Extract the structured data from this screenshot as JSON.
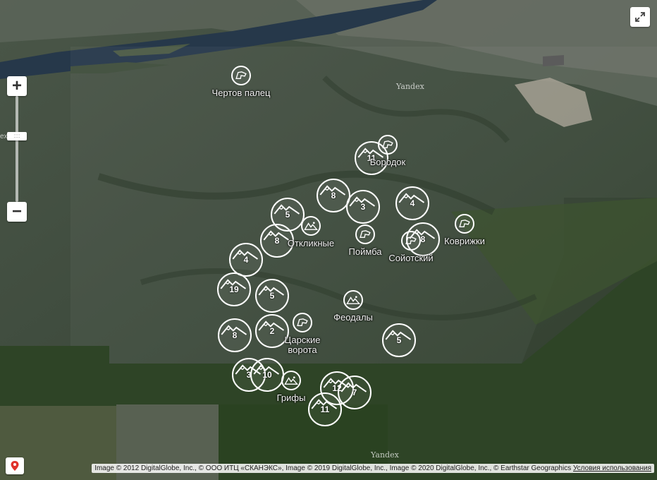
{
  "map": {
    "controls": {
      "zoom_in": "+",
      "zoom_out": "−",
      "zoom_handle": "::::"
    },
    "yandex_labels": [
      "Yandex",
      "Yandex"
    ],
    "edge_label": "ex",
    "copyright": {
      "text": "Image © 2012 DigitalGlobe, Inc., © ООО ИТЦ «СКАНЭКС», Image © 2019 DigitalGlobe, Inc., Image © 2020 DigitalGlobe, Inc., © Earthstar Geographics",
      "terms_link": "Условия использования"
    },
    "colors": {
      "river": "#26384a",
      "forest": "#33402f",
      "marker_stroke": "#ffffff"
    }
  },
  "places": [
    {
      "label": "Чертов палец",
      "icon": "rock-icon"
    },
    {
      "label": "Бородок",
      "icon": "rock-icon"
    },
    {
      "label": "Откликные",
      "icon": "rocks-icon"
    },
    {
      "label": "Поймба",
      "icon": "rock-icon"
    },
    {
      "label": "Сойотский",
      "icon": "rock-icon"
    },
    {
      "label": "Коврижки",
      "icon": "rock-icon"
    },
    {
      "label": "Феодалы",
      "icon": "rocks-icon"
    },
    {
      "label": "Царские ворота",
      "icon": "rock-icon"
    },
    {
      "label": "Грифы",
      "icon": "rocks-icon"
    }
  ],
  "clusters": [
    {
      "count": "11",
      "icon": "mountain-icon"
    },
    {
      "count": "8",
      "icon": "mountain-icon"
    },
    {
      "count": "3",
      "icon": "mountain-icon"
    },
    {
      "count": "4",
      "icon": "mountain-icon"
    },
    {
      "count": "5",
      "icon": "mountain-icon"
    },
    {
      "count": "8",
      "icon": "mountain-icon"
    },
    {
      "count": "8",
      "icon": "mountain-icon"
    },
    {
      "count": "4",
      "icon": "mountain-icon"
    },
    {
      "count": "19",
      "icon": "mountain-icon"
    },
    {
      "count": "5",
      "icon": "mountain-icon"
    },
    {
      "count": "8",
      "icon": "mountain-icon"
    },
    {
      "count": "2",
      "icon": "mountain-icon"
    },
    {
      "count": "5",
      "icon": "mountain-icon"
    },
    {
      "count": "3",
      "icon": "mountain-icon"
    },
    {
      "count": "10",
      "icon": "mountain-icon"
    },
    {
      "count": "12",
      "icon": "mountain-icon"
    },
    {
      "count": "7",
      "icon": "mountain-icon"
    },
    {
      "count": "11",
      "icon": "mountain-icon"
    }
  ]
}
